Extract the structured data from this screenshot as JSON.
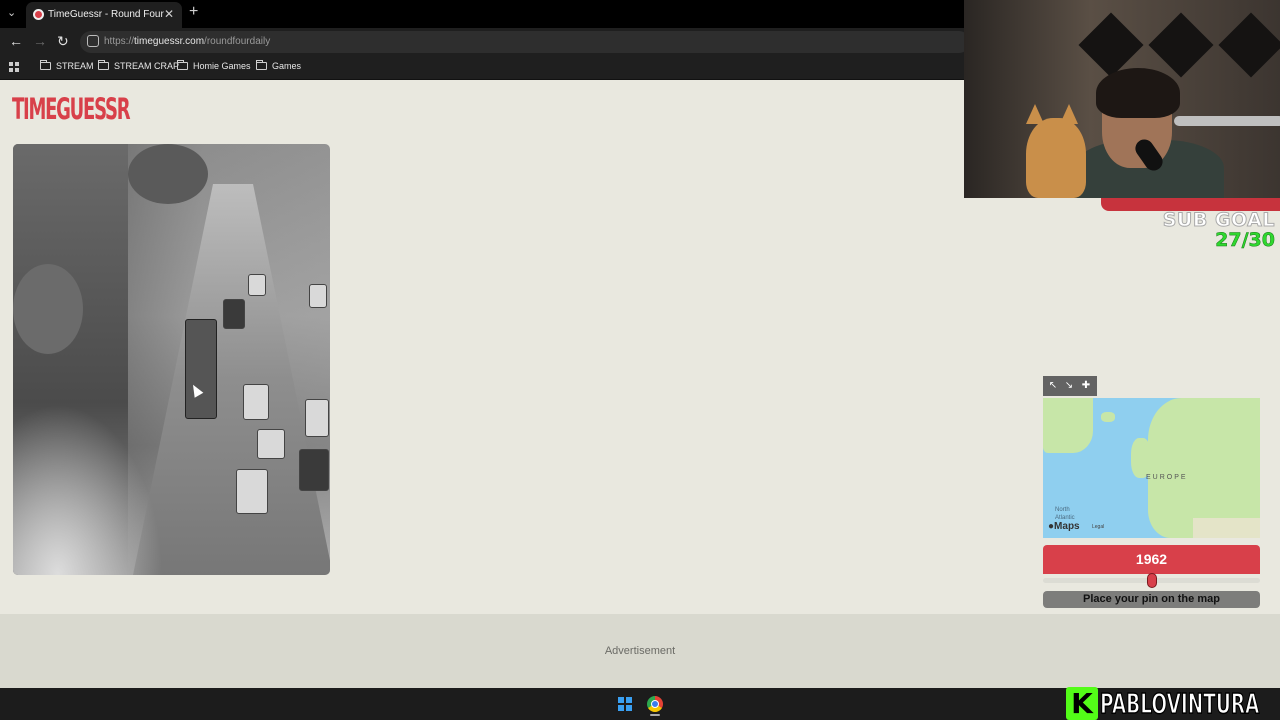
{
  "browser": {
    "tab_title": "TimeGuessr - Round Four",
    "url_prefix": "https://",
    "url_host": "timeguessr.com",
    "url_path": "/roundfourdaily",
    "bookmarks": [
      "STREAM",
      "STREAM CRAP",
      "Homie Games",
      "Games"
    ]
  },
  "page": {
    "logo_text": "TIMEGUESSR",
    "year_value": "1962",
    "year_slider_fraction": 0.5,
    "pin_button_label": "Place your pin on the map",
    "map": {
      "region_label": "EUROPE",
      "ocean_label_1": "North",
      "ocean_label_2": "Atlantic",
      "maps_brand": "Maps",
      "legal_label": "Legal",
      "tools": [
        "resize-nw-icon",
        "resize-se-icon",
        "pin-icon"
      ]
    },
    "advertisement_label": "Advertisement"
  },
  "overlay": {
    "subgoal_label": "SUB GOAL",
    "subgoal_count": "27/30",
    "streamer_badge": "K",
    "streamer_name": "PABLOVINTURA"
  },
  "colors": {
    "brand_red": "#d8404a",
    "page_bg": "#e9e8df",
    "kick_green": "#53fc18",
    "subgoal_green": "#2fd82f"
  }
}
